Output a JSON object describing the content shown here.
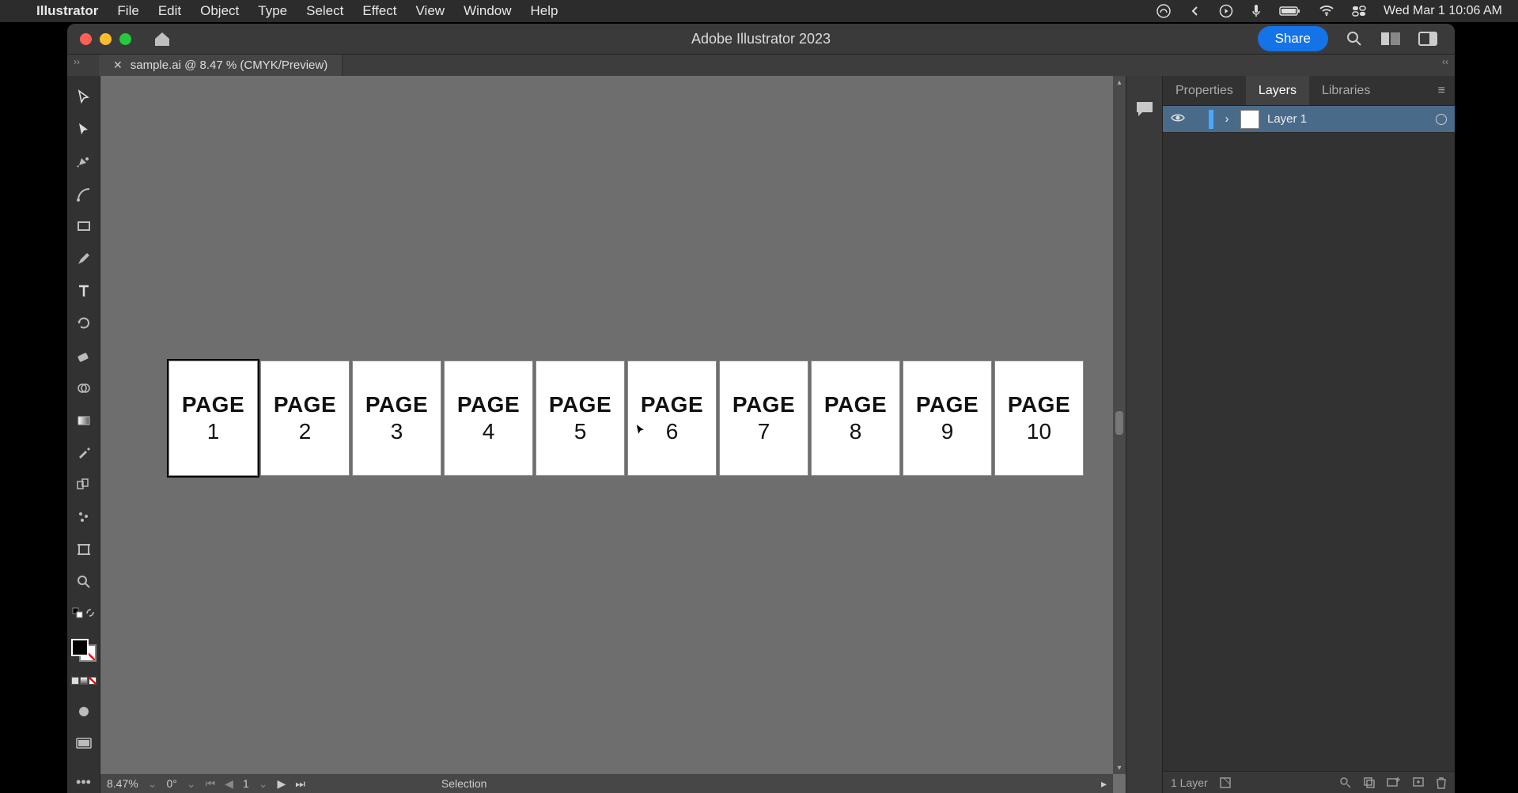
{
  "menubar": {
    "app_name": "Illustrator",
    "items": [
      "File",
      "Edit",
      "Object",
      "Type",
      "Select",
      "Effect",
      "View",
      "Window",
      "Help"
    ],
    "clock": "Wed Mar 1  10:06 AM"
  },
  "titlebar": {
    "app_title": "Adobe Illustrator 2023",
    "share_label": "Share"
  },
  "document": {
    "tab_label": "sample.ai @ 8.47 % (CMYK/Preview)"
  },
  "canvas": {
    "artboards": [
      {
        "label": "PAGE",
        "num": "1",
        "active": true
      },
      {
        "label": "PAGE",
        "num": "2",
        "active": false
      },
      {
        "label": "PAGE",
        "num": "3",
        "active": false
      },
      {
        "label": "PAGE",
        "num": "4",
        "active": false
      },
      {
        "label": "PAGE",
        "num": "5",
        "active": false
      },
      {
        "label": "PAGE",
        "num": "6",
        "active": false
      },
      {
        "label": "PAGE",
        "num": "7",
        "active": false
      },
      {
        "label": "PAGE",
        "num": "8",
        "active": false
      },
      {
        "label": "PAGE",
        "num": "9",
        "active": false
      },
      {
        "label": "PAGE",
        "num": "10",
        "active": false
      }
    ]
  },
  "statusbar": {
    "zoom": "8.47%",
    "rotate": "0°",
    "artboard_nav": "1",
    "tool": "Selection"
  },
  "panels": {
    "tabs": [
      "Properties",
      "Layers",
      "Libraries"
    ],
    "active_tab": "Layers",
    "layers": [
      {
        "name": "Layer 1"
      }
    ],
    "status": "1 Layer"
  },
  "tools": [
    "selection-tool",
    "direct-selection-tool",
    "pen-tool",
    "curvature-tool",
    "rectangle-tool",
    "paintbrush-tool",
    "type-tool",
    "rotate-tool",
    "eraser-tool",
    "shape-builder-tool",
    "gradient-tool",
    "eyedropper-tool",
    "blend-tool",
    "symbol-sprayer-tool",
    "artboard-tool",
    "zoom-tool"
  ]
}
